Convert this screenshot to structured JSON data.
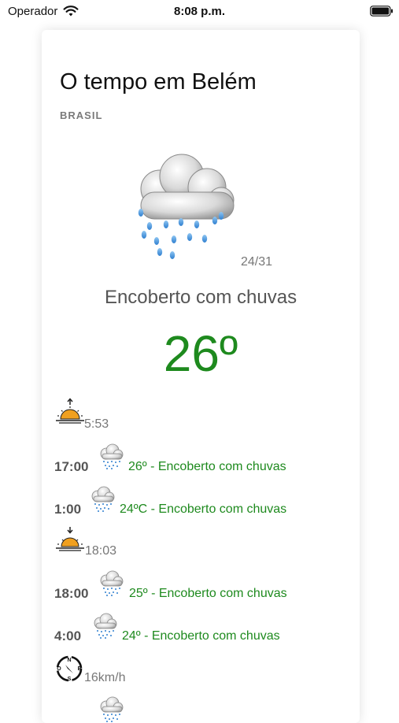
{
  "status": {
    "carrier": "Operador",
    "time": "8:08 p.m."
  },
  "weather": {
    "title": "O tempo em Belém",
    "country": "BRASIL",
    "minmax": "24/31",
    "condition": "Encoberto com chuvas",
    "temperature": "26º"
  },
  "details": {
    "sunrise": "5:53",
    "sunset": "18:03",
    "wind": "16km/h",
    "forecast": [
      {
        "time": "17:00",
        "desc": "26º - Encoberto com chuvas"
      },
      {
        "time": "1:00",
        "desc": "24ºC - Encoberto com chuvas"
      },
      {
        "time": "18:00",
        "desc": "25º - Encoberto com chuvas"
      },
      {
        "time": "4:00",
        "desc": "24º - Encoberto com chuvas"
      }
    ]
  },
  "icons": {
    "wifi": "wifi-icon",
    "battery": "battery-icon",
    "main": "rain-cloud-icon",
    "sunrise": "sunrise-icon",
    "sunset": "sunset-icon",
    "forecast": "rain-cloud-icon",
    "wind": "compass-icon"
  },
  "colors": {
    "accent_green": "#1e8a1e",
    "muted_text": "#777777",
    "sun_orange": "#f0a020"
  }
}
